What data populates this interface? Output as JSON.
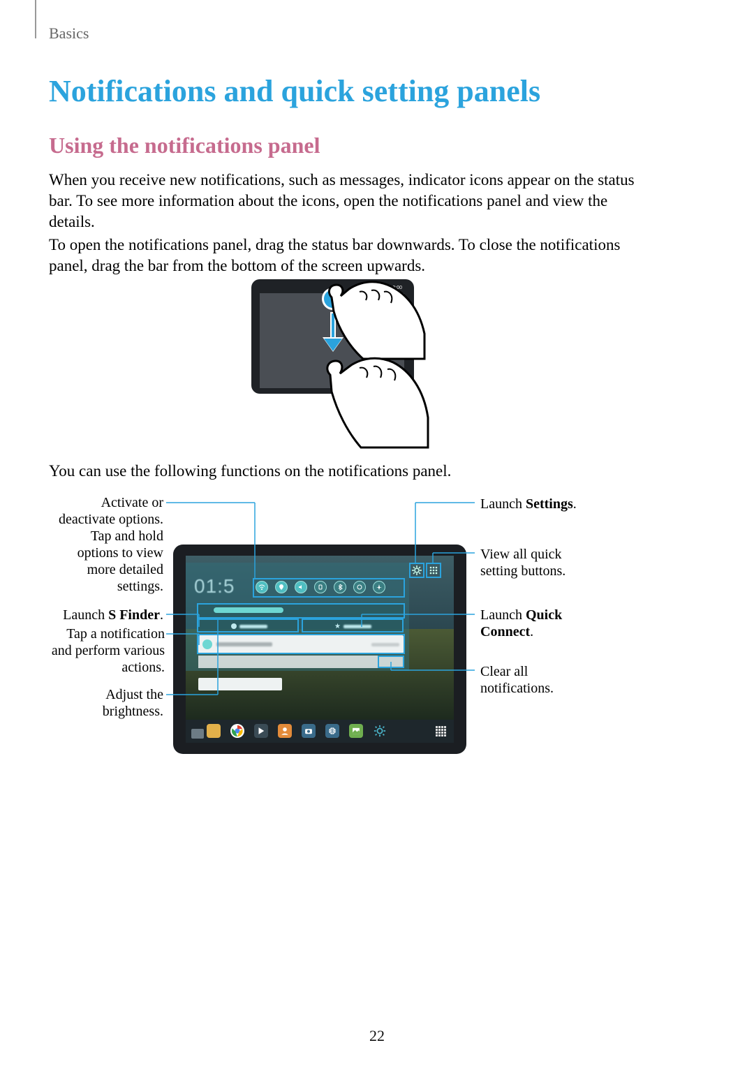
{
  "breadcrumb": "Basics",
  "title": "Notifications and quick setting panels",
  "subtitle": "Using the notifications panel",
  "paragraph1": "When you receive new notifications, such as messages, indicator icons appear on the status bar. To see more information about the icons, open the notifications panel and view the details.",
  "paragraph2": "To open the notifications panel, drag the status bar downwards. To close the notifications panel, drag the bar from the bottom of the screen upwards.",
  "illustration1": {
    "status_time": "10:00"
  },
  "paragraph3": "You can use the following functions on the notifications panel.",
  "callouts": {
    "left": [
      "Activate or deactivate options. Tap and hold options to view more detailed settings.",
      {
        "pre": "Launch ",
        "bold": "S Finder",
        "post": "."
      },
      "Tap a notification and perform various actions.",
      "Adjust the brightness."
    ],
    "right": [
      {
        "pre": "Launch ",
        "bold": "Settings",
        "post": "."
      },
      "View all quick setting buttons.",
      {
        "pre": "Launch ",
        "bold": "Quick Connect",
        "post": "."
      },
      "Clear all notifications."
    ]
  },
  "screenshot_panel": {
    "time": "01:5",
    "quick_settings": [
      "wifi",
      "location",
      "sound",
      "rotate",
      "bluetooth",
      "sync",
      "airplane"
    ],
    "top_right_icons": [
      "settings",
      "expand"
    ]
  },
  "page_number": "22"
}
